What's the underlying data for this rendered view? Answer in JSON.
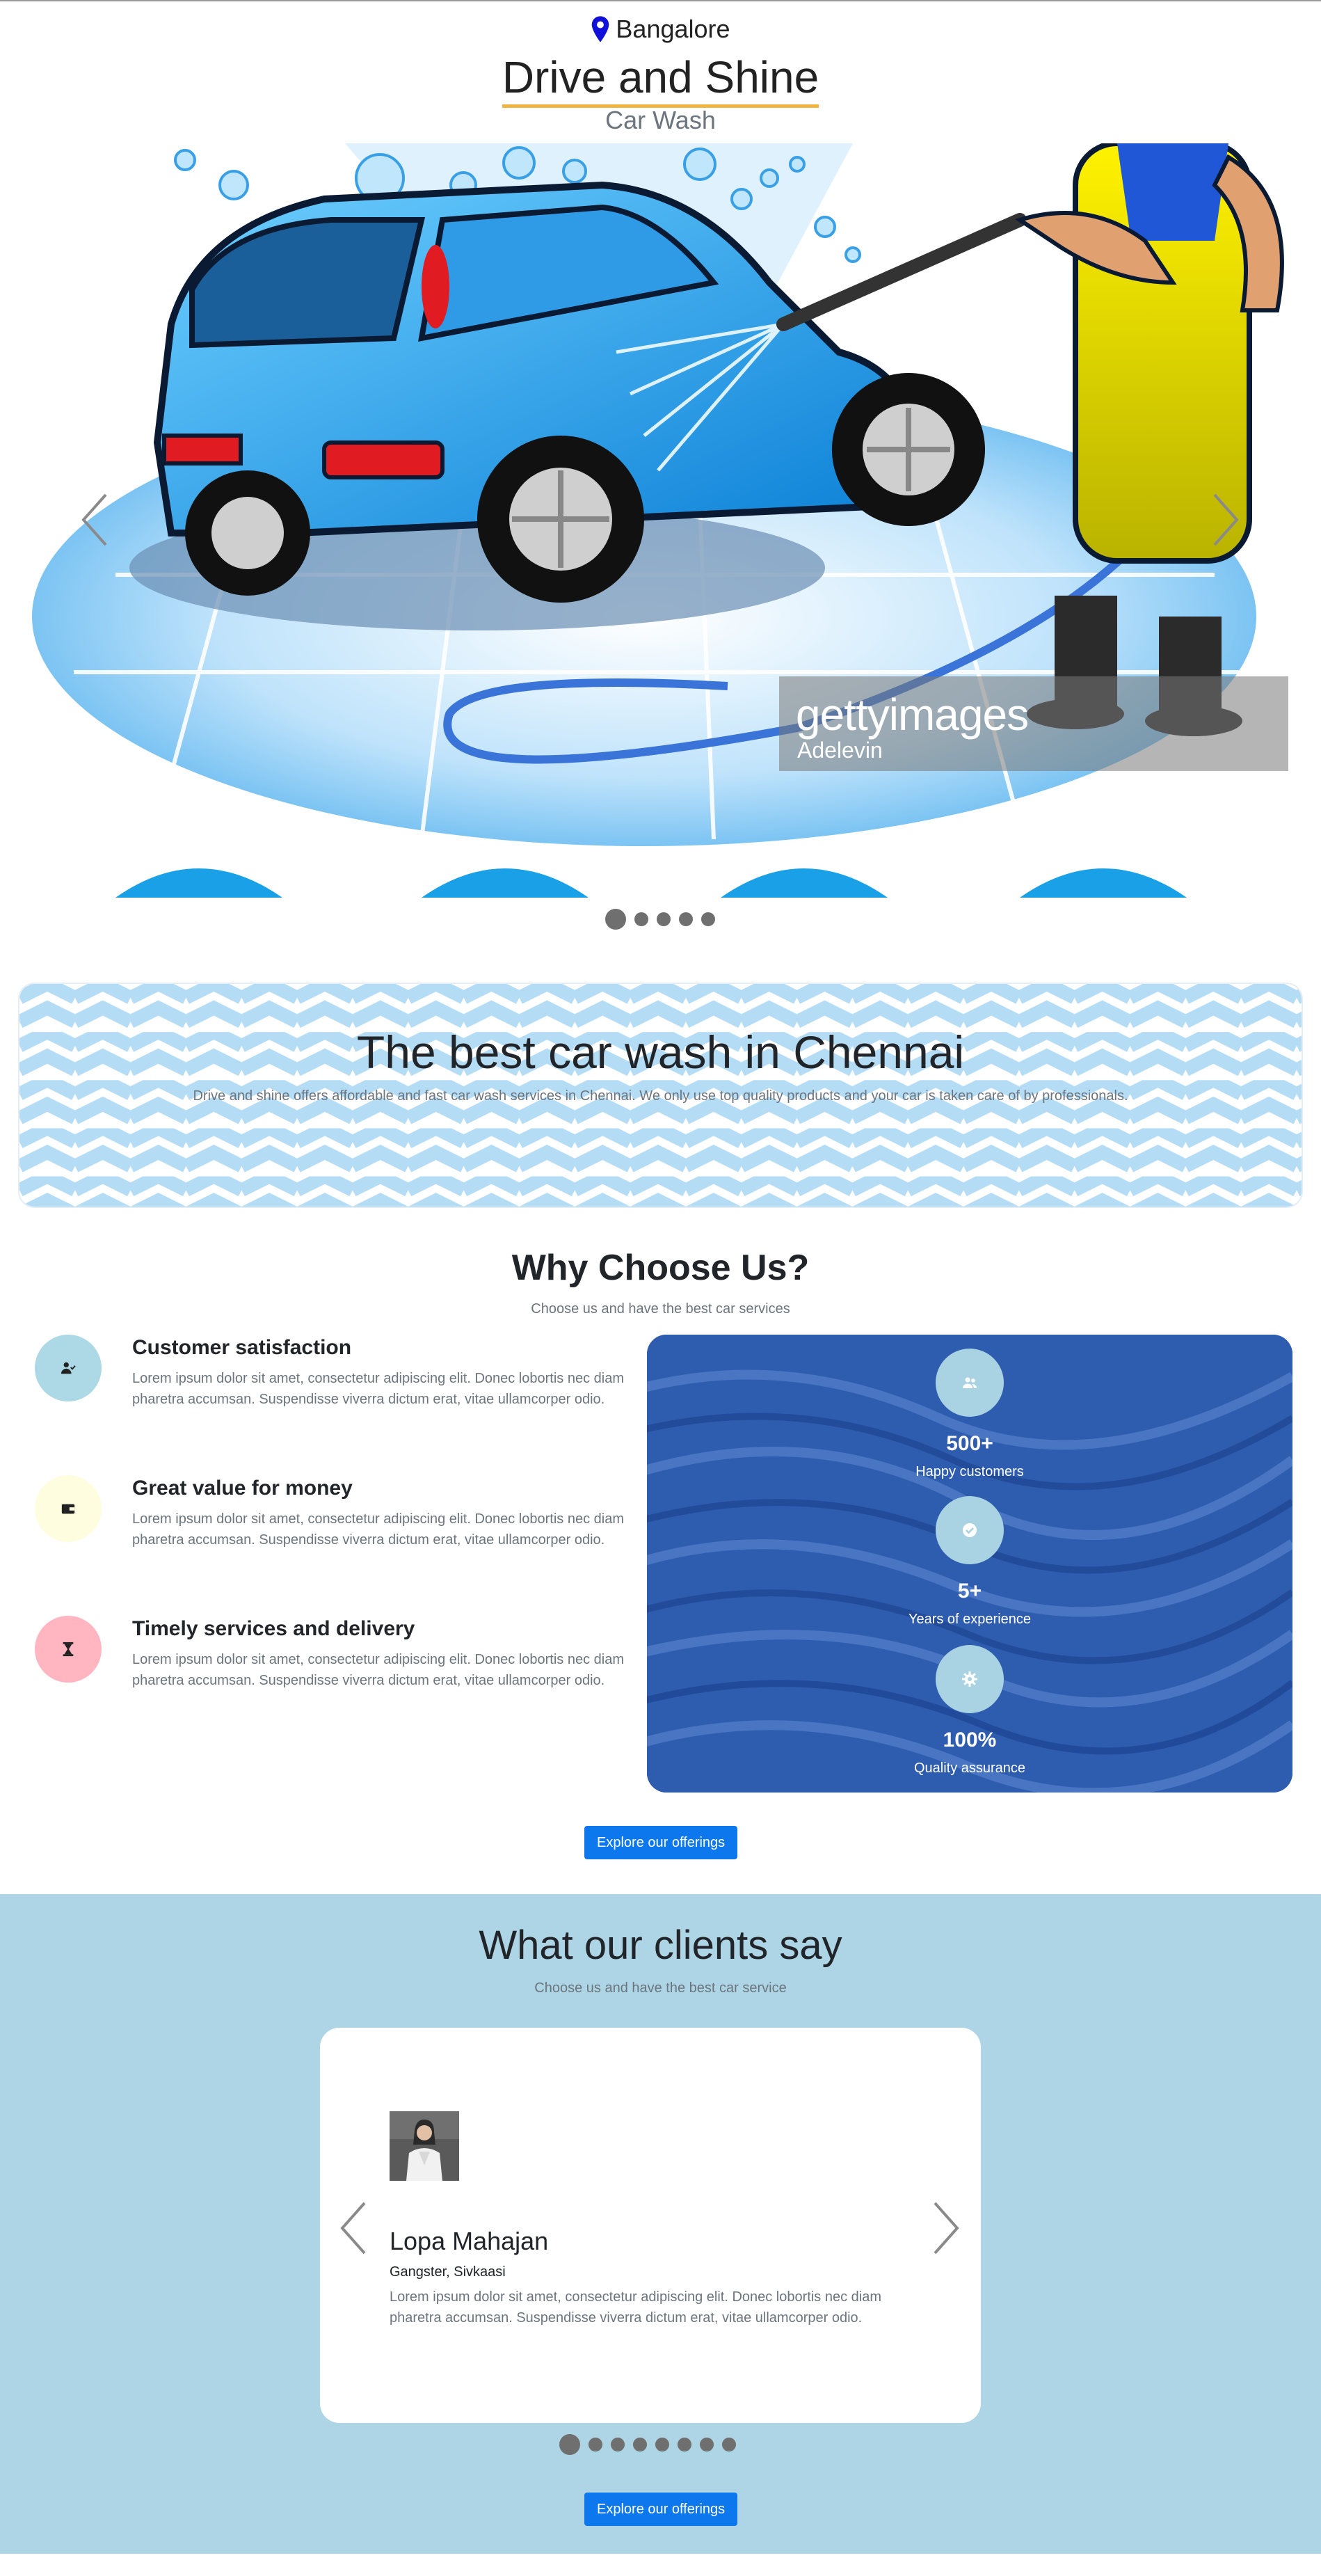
{
  "header": {
    "location": "Bangalore",
    "location_icon": "map-pin-icon",
    "brand": "Drive and Shine",
    "subtitle": "Car Wash"
  },
  "hero": {
    "watermark_brand": "gettyimages",
    "watermark_credit": "Adelevin",
    "slide_count": 5,
    "active_slide": 1
  },
  "banner": {
    "title": "The best car wash in Chennai",
    "text": "Drive and shine offers affordable and fast car wash services in Chennai. We only use top quality products and your car is taken care of by professionals."
  },
  "why": {
    "title": "Why Choose Us?",
    "subtitle": "Choose us and have the best car services",
    "features": [
      {
        "title": "Customer satisfaction",
        "text": "Lorem ipsum dolor sit amet, consectetur adipiscing elit. Donec lobortis nec diam pharetra accumsan. Suspendisse viverra dictum erat, vitae ullamcorper odio.",
        "icon": "user-check-icon",
        "color": "#add8e6"
      },
      {
        "title": "Great value for money",
        "text": "Lorem ipsum dolor sit amet, consectetur adipiscing elit. Donec lobortis nec diam pharetra accumsan. Suspendisse viverra dictum erat, vitae ullamcorper odio.",
        "icon": "wallet-icon",
        "color": "#fffde0"
      },
      {
        "title": "Timely services and delivery",
        "text": "Lorem ipsum dolor sit amet, consectetur adipiscing elit. Donec lobortis nec diam pharetra accumsan. Suspendisse viverra dictum erat, vitae ullamcorper odio.",
        "icon": "hourglass-icon",
        "color": "#ffb6c1"
      }
    ],
    "stats": [
      {
        "value": "500+",
        "label": "Happy customers",
        "icon": "users-icon"
      },
      {
        "value": "5+",
        "label": "Years of experience",
        "icon": "check-circle-icon"
      },
      {
        "value": "100%",
        "label": "Quality assurance",
        "icon": "gear-icon"
      }
    ],
    "button": "Explore our offerings"
  },
  "clients": {
    "title": "What our clients say",
    "subtitle": "Choose us and have the best car service",
    "testimonial": {
      "name": "Lopa Mahajan",
      "role": "Gangster, Sivkaasi",
      "quote": "Lorem ipsum dolor sit amet, consectetur adipiscing elit. Donec lobortis nec diam pharetra accumsan. Suspendisse viverra dictum erat, vitae ullamcorper odio."
    },
    "slide_count": 8,
    "active_slide": 1,
    "button": "Explore our offerings"
  },
  "colors": {
    "accent": "#0d77ee",
    "underline": "#f0b543",
    "clients_bg": "#add5e5",
    "stats_bg": "#2f5fb3"
  }
}
